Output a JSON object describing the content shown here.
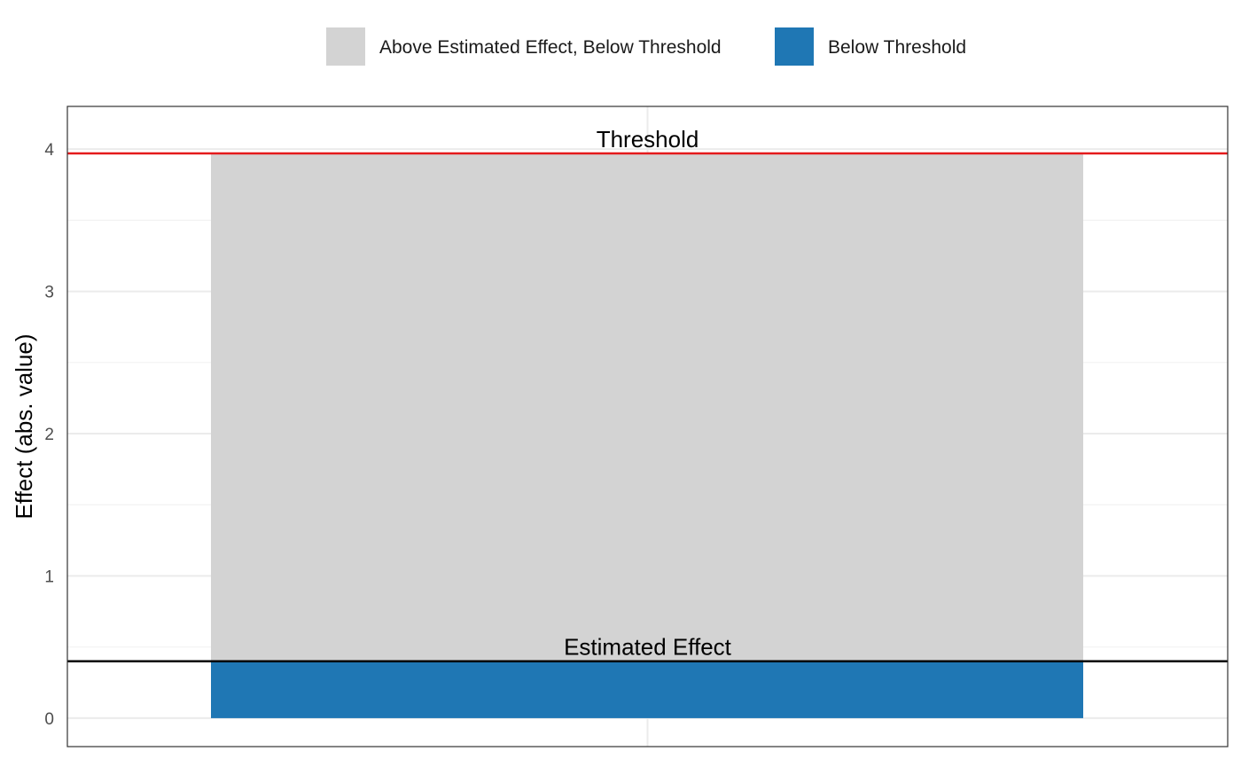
{
  "chart_data": {
    "type": "bar",
    "stacked": true,
    "categories": [
      ""
    ],
    "series": [
      {
        "name": "Below Threshold",
        "values": [
          0.4
        ],
        "color": "#1f77b4"
      },
      {
        "name": "Above Estimated Effect, Below Threshold",
        "values": [
          3.57
        ],
        "color": "#d3d3d3"
      }
    ],
    "legend": {
      "placement": "top",
      "items": [
        {
          "label": "Above Estimated Effect, Below Threshold",
          "color": "#d3d3d3"
        },
        {
          "label": "Below Threshold",
          "color": "#1f77b4"
        }
      ]
    },
    "reference_lines": [
      {
        "label": "Threshold",
        "value": 3.97,
        "color": "#e41a1c"
      },
      {
        "label": "Estimated Effect",
        "value": 0.4,
        "color": "#000000"
      }
    ],
    "title": "",
    "xlabel": "",
    "ylabel": "Effect (abs. value)",
    "ylim": [
      -0.2,
      4.3
    ],
    "yticks": [
      0,
      1,
      2,
      3,
      4
    ],
    "ytick_labels": [
      "0",
      "1",
      "2",
      "3",
      "4"
    ],
    "grid": true
  }
}
